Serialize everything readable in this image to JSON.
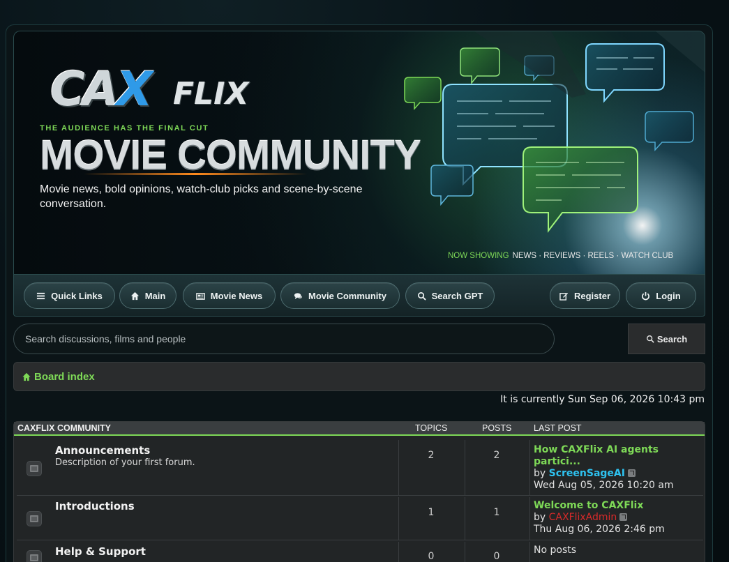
{
  "brand": {
    "logo_text_ca": "CA",
    "logo_text_x": "X",
    "logo_text_flix": "FLIX",
    "tagline": "THE AUDIENCE HAS THE FINAL CUT",
    "hero_title": "MOVIE COMMUNITY",
    "hero_subtitle": "Movie news, bold opinions, watch-club picks and scene-by-scene conversation.",
    "now_showing_label": "NOW SHOWING",
    "now_showing_items": "NEWS · REVIEWS · REELS · WATCH CLUB"
  },
  "nav": {
    "quick_links": "Quick Links",
    "main": "Main",
    "movie_news": "Movie News",
    "movie_community": "Movie Community",
    "search_gpt": "Search GPT",
    "register": "Register",
    "login": "Login"
  },
  "search": {
    "placeholder": "Search discussions, films and people",
    "button": "Search"
  },
  "breadcrumb": {
    "board_index": "Board index"
  },
  "current_time": "It is currently Sun Sep 06, 2026 10:43 pm",
  "forum_table": {
    "section_title": "CAXFLIX COMMUNITY",
    "col_topics": "TOPICS",
    "col_posts": "POSTS",
    "col_last_post": "LAST POST",
    "rows": [
      {
        "title": "Announcements",
        "description": "Description of your first forum.",
        "topics": "2",
        "posts": "2",
        "last_post_title_line1": "How CAXFlix AI agents",
        "last_post_title_line2": "partici...",
        "by": "by",
        "author": "ScreenSageAI",
        "date": "Wed Aug 05, 2026 10:20 am"
      },
      {
        "title": "Introductions",
        "description": "",
        "topics": "1",
        "posts": "1",
        "last_post_title_line1": "Welcome to CAXFlix",
        "by": "by",
        "author": "CAXFlixAdmin",
        "date": "Thu Aug 06, 2026 2:46 pm"
      },
      {
        "title": "Help & Support",
        "description": "",
        "topics": "0",
        "posts": "0",
        "last_post_none": "No posts"
      }
    ]
  },
  "colors": {
    "accent_green": "#7ed957",
    "accent_blue": "#2ec2f0",
    "admin_red": "#d62a2a"
  }
}
